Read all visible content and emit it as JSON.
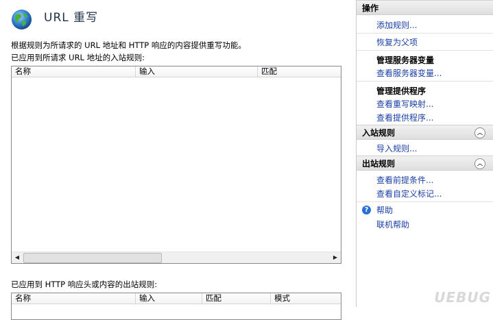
{
  "header": {
    "title": "URL 重写",
    "icon": "globe-icon"
  },
  "description": "根据规则为所请求的 URL 地址和 HTTP 响应的内容提供重写功能。",
  "inbound": {
    "label": "已应用到所请求 URL 地址的入站规则:",
    "columns": [
      "名称",
      "输入",
      "匹配"
    ],
    "rows": []
  },
  "outbound": {
    "label": "已应用到 HTTP 响应头或内容的出站规则:",
    "columns": [
      "名称",
      "输入",
      "匹配",
      "模式"
    ],
    "rows": []
  },
  "actions": {
    "title": "操作",
    "add_rule": "添加规则...",
    "revert_parent": "恢复为父项",
    "server_vars_group": "管理服务器变量",
    "view_server_vars": "查看服务器变量...",
    "providers_group": "管理提供程序",
    "view_rewrite_maps": "查看重写映射...",
    "view_providers": "查看提供程序...",
    "inbound_section": "入站规则",
    "import_rules": "导入规则...",
    "outbound_section": "出站规则",
    "view_preconditions": "查看前提条件...",
    "view_custom_tags": "查看自定义标记...",
    "help": "帮助",
    "online_help": "联机帮助"
  },
  "watermark": "UEBUG"
}
